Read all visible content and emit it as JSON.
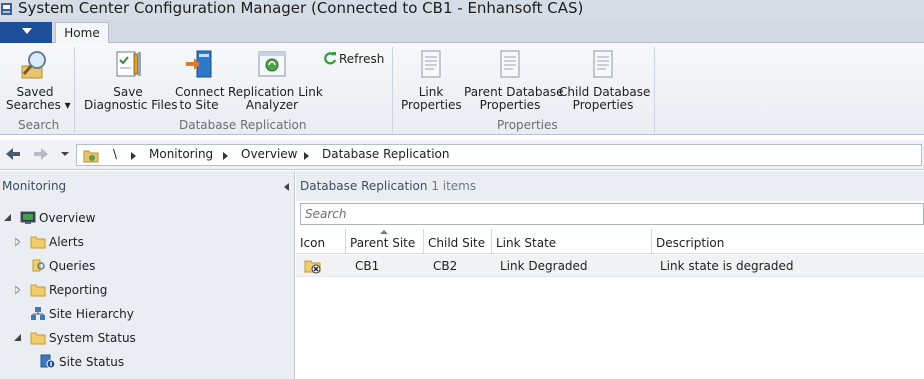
{
  "window": {
    "title": "System Center Configuration Manager (Connected to CB1 - Enhansoft CAS)"
  },
  "tabs": {
    "home": "Home"
  },
  "ribbon": {
    "saved_searches": {
      "line1": "Saved",
      "line2": "Searches ▾"
    },
    "save_diagnostic": {
      "line1": "Save",
      "line2": "Diagnostic Files"
    },
    "connect_site": {
      "line1": "Connect",
      "line2": "to Site"
    },
    "replication_analyzer": {
      "line1": "Replication Link",
      "line2": "Analyzer"
    },
    "refresh": "Refresh",
    "link_properties": {
      "line1": "Link",
      "line2": "Properties"
    },
    "parent_db_properties": {
      "line1": "Parent Database",
      "line2": "Properties"
    },
    "child_db_properties": {
      "line1": "Child Database",
      "line2": "Properties"
    },
    "groups": {
      "search": "Search",
      "database_replication": "Database Replication",
      "properties": "Properties"
    }
  },
  "navigation": {
    "root": "\\",
    "breadcrumbs": [
      "Monitoring",
      "Overview",
      "Database Replication"
    ]
  },
  "left_pane": {
    "title": "Monitoring",
    "tree": [
      {
        "label": "Overview",
        "icon": "overview-icon",
        "expanded": true
      },
      {
        "label": "Alerts",
        "icon": "folder-icon",
        "expanded": false
      },
      {
        "label": "Queries",
        "icon": "queries-icon"
      },
      {
        "label": "Reporting",
        "icon": "folder-icon",
        "expanded": false
      },
      {
        "label": "Site Hierarchy",
        "icon": "site-hierarchy-icon"
      },
      {
        "label": "System Status",
        "icon": "folder-icon",
        "expanded": true
      },
      {
        "label": "Site Status",
        "icon": "site-status-icon"
      }
    ]
  },
  "main": {
    "title": "Database Replication",
    "count": "1 items",
    "search_placeholder": "Search",
    "columns": [
      "Icon",
      "Parent Site",
      "Child Site",
      "Link State",
      "Description"
    ],
    "rows": [
      {
        "icon": "link-degraded-icon",
        "parent_site": "CB1",
        "child_site": "CB2",
        "link_state": "Link Degraded",
        "description": "Link state is degraded"
      }
    ]
  },
  "colors": {
    "file_menu": "#1e4e9a",
    "pane_header": "#eaeef3",
    "title_bar": "#d7dde6"
  }
}
